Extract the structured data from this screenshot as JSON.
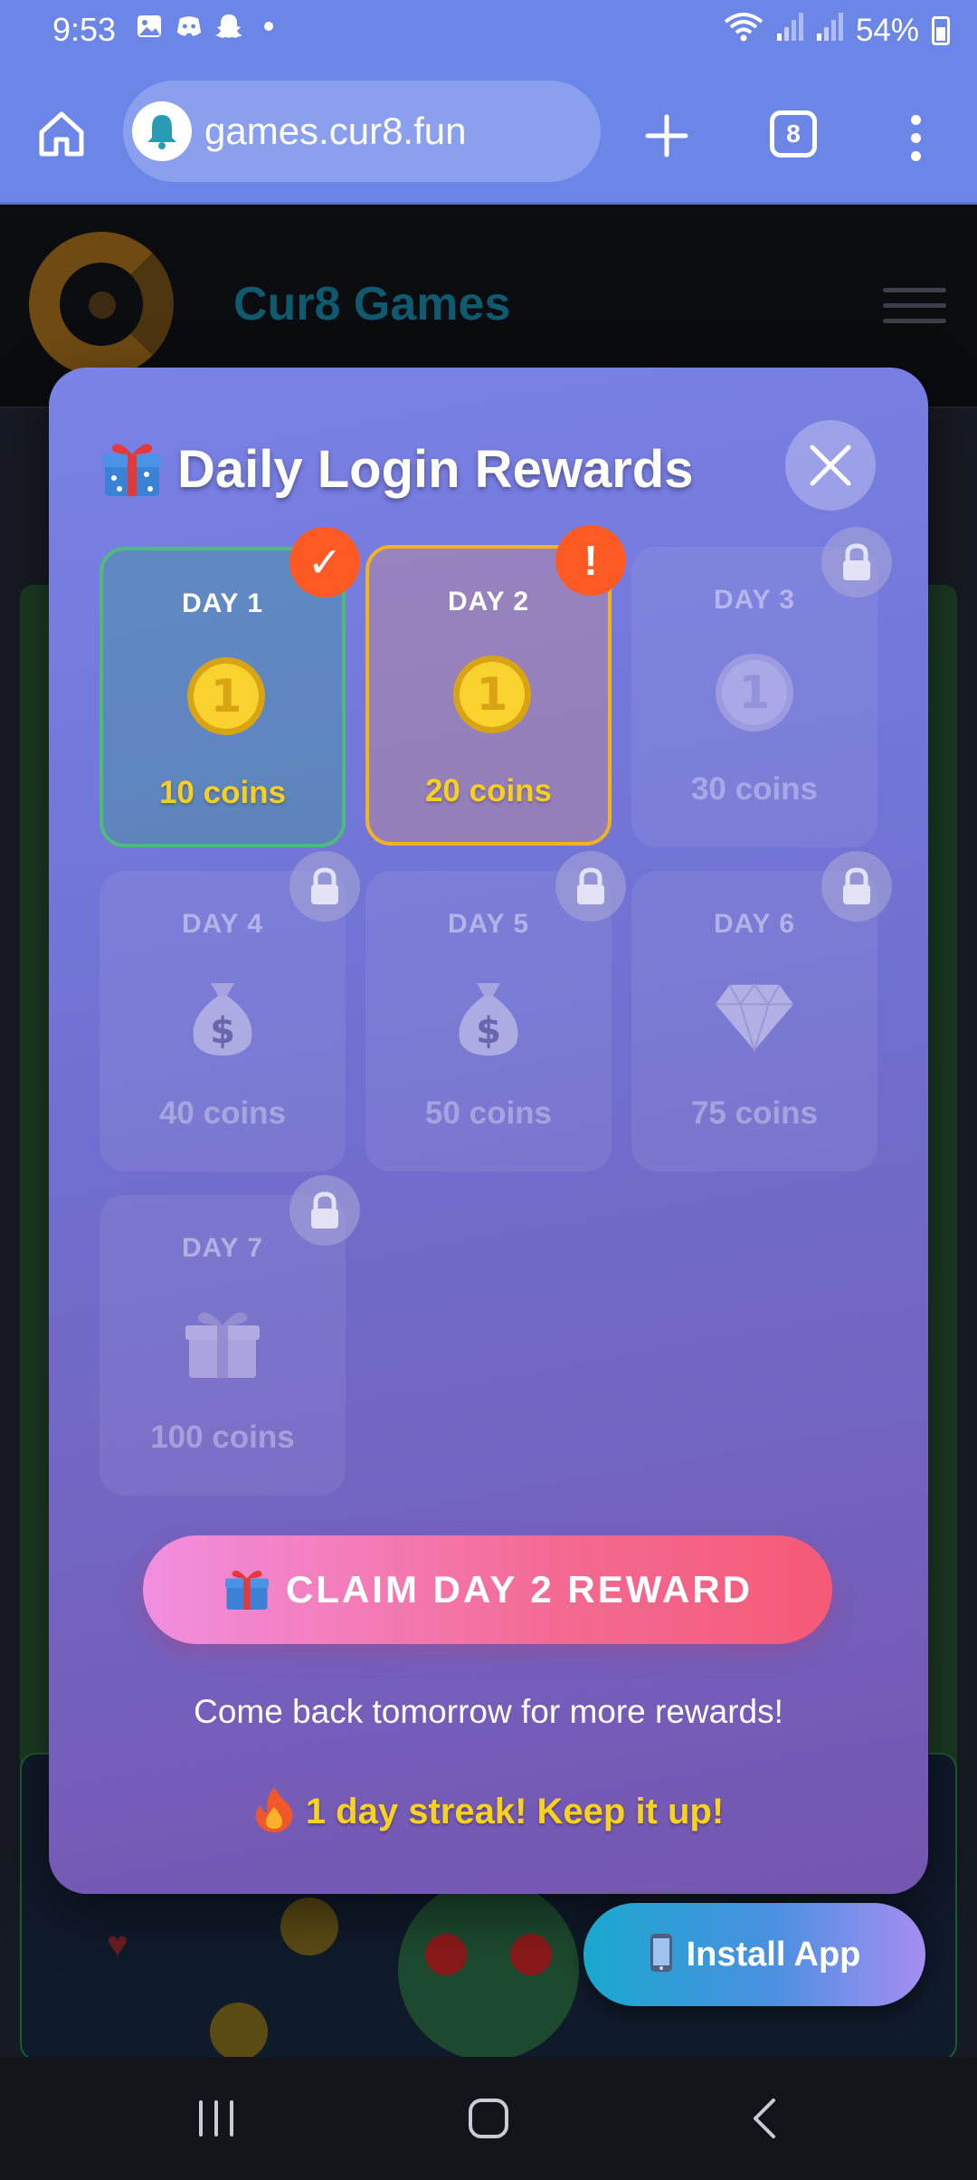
{
  "status_bar": {
    "time": "9:53",
    "battery": "54%",
    "icons": [
      "gallery-icon",
      "discord-icon",
      "snapchat-icon",
      "dot-icon",
      "wifi-icon",
      "signal-icon",
      "signal-icon",
      "battery-icon"
    ]
  },
  "browser": {
    "url": "games.cur8.fun",
    "tab_count": "8"
  },
  "site": {
    "name": "Cur8 Games"
  },
  "modal": {
    "title": "Daily Login Rewards",
    "days": [
      {
        "label": "DAY 1",
        "amount": "10 coins",
        "state": "claimed",
        "icon": "coin"
      },
      {
        "label": "DAY 2",
        "amount": "20 coins",
        "state": "current",
        "icon": "coin"
      },
      {
        "label": "DAY 3",
        "amount": "30 coins",
        "state": "locked",
        "icon": "coin"
      },
      {
        "label": "DAY 4",
        "amount": "40 coins",
        "state": "locked",
        "icon": "money-bag"
      },
      {
        "label": "DAY 5",
        "amount": "50 coins",
        "state": "locked",
        "icon": "money-bag"
      },
      {
        "label": "DAY 6",
        "amount": "75 coins",
        "state": "locked",
        "icon": "diamond"
      },
      {
        "label": "DAY 7",
        "amount": "100 coins",
        "state": "locked",
        "icon": "gift"
      }
    ],
    "claim_button": "CLAIM DAY 2 REWARD",
    "come_back_text": "Come back tomorrow for more rewards!",
    "streak_text": "1 day streak! Keep it up!"
  },
  "install_button": "Install App",
  "colors": {
    "browser_bar": "#6c86e8",
    "coin_gold": "#f6cf22",
    "badge_orange": "#ff5a24",
    "claimed_border": "#4dbb7c",
    "current_border": "#f3b221"
  }
}
